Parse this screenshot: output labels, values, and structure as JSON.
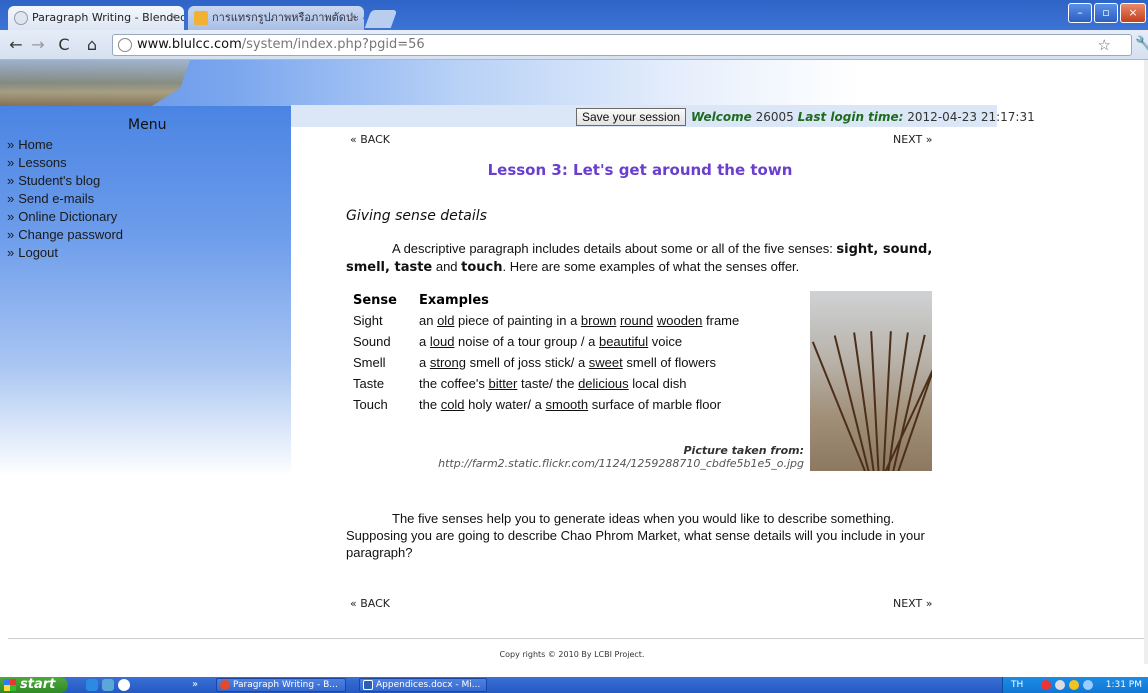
{
  "browser": {
    "tabs": [
      {
        "title": "Paragraph Writing - Blended Le",
        "active": true
      },
      {
        "title": "การแทรกรูปภาพหรือภาพตัดปะ -",
        "active": false
      }
    ],
    "close_glyph": "×",
    "url_domain": "www.blulcc.com",
    "url_path": "/system/index.php?pgid=56",
    "icons": [
      "back-icon",
      "forward-icon",
      "reload-icon",
      "home-icon",
      "star-icon",
      "wrench-icon"
    ]
  },
  "sidebar": {
    "menu_title": "Menu",
    "items": [
      {
        "label": "Home"
      },
      {
        "label": "Lessons"
      },
      {
        "label": "Student's blog"
      },
      {
        "label": "Send e-mails"
      },
      {
        "label": "Online Dictionary"
      },
      {
        "label": "Change password"
      },
      {
        "label": "Logout"
      }
    ],
    "arrow": "»"
  },
  "header": {
    "save_button": "Save your session",
    "welcome_label": "Welcome",
    "user_id": "26005",
    "last_login_label": "Last login time:",
    "last_login_value": "2012-04-23 21:17:31"
  },
  "nav": {
    "back": "« BACK",
    "next": "NEXT »"
  },
  "lesson": {
    "title": "Lesson 3: Let's get around the town",
    "section": "Giving sense details",
    "intro_parts": [
      "A descriptive paragraph includes details about some or all of the five senses: ",
      "sight, sound, smell, taste",
      " and ",
      "touch",
      ". Here are some examples of what the senses offer."
    ],
    "table": {
      "headers": [
        "Sense",
        "Examples"
      ],
      "rows": [
        {
          "sense": "Sight",
          "parts": [
            "an ",
            "old",
            " piece of painting in a ",
            "brown",
            " ",
            "round",
            " ",
            "wooden",
            " frame"
          ]
        },
        {
          "sense": "Sound",
          "parts": [
            "a ",
            "loud",
            " noise of a tour group / a ",
            "beautiful",
            " voice"
          ]
        },
        {
          "sense": "Smell",
          "parts": [
            "a ",
            "strong",
            " smell of joss stick/ a ",
            "sweet",
            " smell of flowers"
          ]
        },
        {
          "sense": "Taste",
          "parts": [
            "the coffee's ",
            "bitter",
            " taste/ the ",
            "delicious",
            " local dish"
          ]
        },
        {
          "sense": "Touch",
          "parts": [
            "the ",
            "cold",
            " holy water/ a ",
            "smooth",
            " surface of marble floor"
          ]
        }
      ]
    },
    "picture_credit_label": "Picture taken from:",
    "picture_credit_url": "http://farm2.static.flickr.com/1124/1259288710_cbdfe5b1e5_o.jpg",
    "closing": "The five senses help you to generate ideas when you would like to describe something. Supposing you are going to describe Chao Phrom Market, what sense details will you include in your paragraph?"
  },
  "footer": {
    "copyright": "Copy rights © 2010 By LCBI Project."
  },
  "taskbar": {
    "start": "start",
    "tasks": [
      {
        "label": "Paragraph Writing - B..."
      },
      {
        "label": "Appendices.docx - Mi..."
      }
    ],
    "overflow": "»",
    "lang": "TH",
    "clock": "1:31 PM"
  }
}
